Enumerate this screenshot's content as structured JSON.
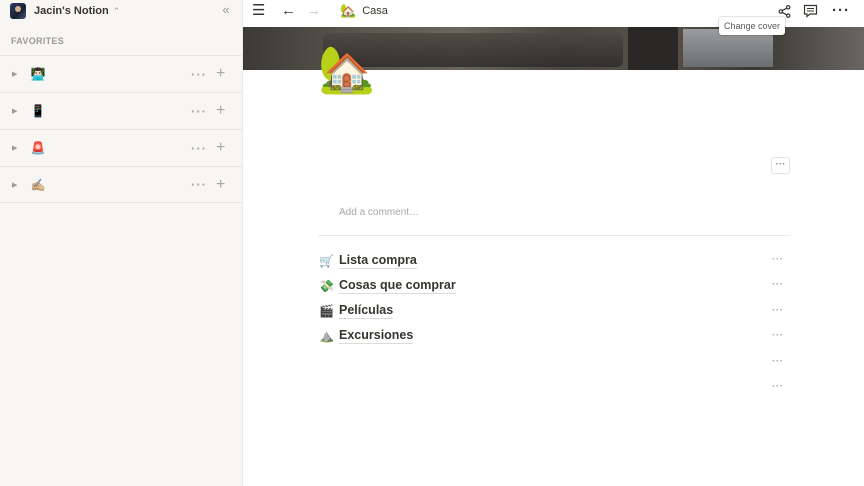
{
  "workspace": {
    "name": "Jacin's Notion"
  },
  "sidebar": {
    "favorites_header": "FAVORITES",
    "items": [
      {
        "emoji": "👨🏻‍💻"
      },
      {
        "emoji": "📱"
      },
      {
        "emoji": "🚨"
      },
      {
        "emoji": "✍🏼"
      }
    ]
  },
  "topbar": {
    "breadcrumb": {
      "emoji": "🏡",
      "label": "Casa"
    },
    "icons": [
      "menu-icon",
      "back-arrow-icon",
      "forward-arrow-icon",
      "share-icon",
      "comment-icon",
      "more-icon"
    ]
  },
  "page": {
    "icon": "🏡",
    "change_cover_label": "Change cover",
    "comment_placeholder": "Add a comment…",
    "subpages": [
      {
        "emoji": "🛒",
        "label": "Lista compra"
      },
      {
        "emoji": "💸",
        "label": "Cosas que comprar"
      },
      {
        "emoji": "🎬",
        "label": "Películas"
      },
      {
        "emoji": "⛰️",
        "label": "Excursiones"
      }
    ]
  }
}
